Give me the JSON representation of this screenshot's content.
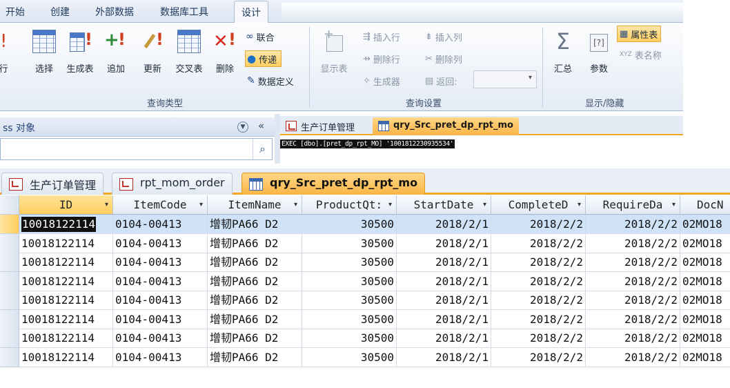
{
  "ribbon_tabs": [
    "开始",
    "创建",
    "外部数据",
    "数据库工具",
    "设计"
  ],
  "ribbon": {
    "left_fragment": "行",
    "query_type": {
      "label": "查询类型",
      "buttons": [
        "选择",
        "生成表",
        "追加",
        "更新",
        "交叉表",
        "删除"
      ],
      "small": [
        "联合",
        "传递",
        "数据定义"
      ]
    },
    "query_setup": {
      "label": "查询设置",
      "show_table": "显示表",
      "insert_row": "插入行",
      "delete_row": "删除行",
      "builder": "生成器",
      "insert_col": "插入列",
      "delete_col": "删除列",
      "return_label": "返回:",
      "return_value": ""
    },
    "show_hide": {
      "label": "显示/隐藏",
      "totals": "汇总",
      "parameters": "参数",
      "property_sheet": "属性表",
      "table_names": "表名称"
    }
  },
  "nav_pane": {
    "title": "ss 对象",
    "search_placeholder": ""
  },
  "query_editor": {
    "tabs": [
      "生产订单管理",
      "qry_Src_pret_dp_rpt_mo"
    ],
    "active_tab": 1,
    "sql": "EXEC [dbo].[pret_dp_rpt_MO] '1001812230935534'"
  },
  "datasheet": {
    "tabs": [
      "生产订单管理",
      "rpt_mom_order",
      "qry_Src_pret_dp_rpt_mo"
    ],
    "active_tab": 2,
    "columns": [
      "ID",
      "ItemCode",
      "ItemName",
      "ProductQt:",
      "StartDate",
      "CompleteD",
      "RequireDa",
      "DocN"
    ],
    "rows": [
      [
        "10018122114",
        "0104-00413",
        "增韧PA66 D2",
        "30500",
        "2018/2/1",
        "2018/2/2",
        "2018/2/2",
        "02MO18"
      ],
      [
        "10018122114",
        "0104-00413",
        "增韧PA66 D2",
        "30500",
        "2018/2/1",
        "2018/2/2",
        "2018/2/2",
        "02MO18"
      ],
      [
        "10018122114",
        "0104-00413",
        "增韧PA66 D2",
        "30500",
        "2018/2/1",
        "2018/2/2",
        "2018/2/2",
        "02MO18"
      ],
      [
        "10018122114",
        "0104-00413",
        "增韧PA66 D2",
        "30500",
        "2018/2/1",
        "2018/2/2",
        "2018/2/2",
        "02MO18"
      ],
      [
        "10018122114",
        "0104-00413",
        "增韧PA66 D2",
        "30500",
        "2018/2/1",
        "2018/2/2",
        "2018/2/2",
        "02MO18"
      ],
      [
        "10018122114",
        "0104-00413",
        "增韧PA66 D2",
        "30500",
        "2018/2/1",
        "2018/2/2",
        "2018/2/2",
        "02MO18"
      ],
      [
        "10018122114",
        "0104-00413",
        "增韧PA66 D2",
        "30500",
        "2018/2/1",
        "2018/2/2",
        "2018/2/2",
        "02MO18"
      ],
      [
        "10018122114",
        "0104-00413",
        "增韧PA66 D2",
        "30500",
        "2018/2/1",
        "2018/2/2",
        "2018/2/2",
        "02MO18"
      ]
    ],
    "current_row": 0
  },
  "colors": {
    "accent_tab": "#f9b546",
    "selected_row": "#cfe2f7",
    "ribbon_text": "#1e395b"
  }
}
